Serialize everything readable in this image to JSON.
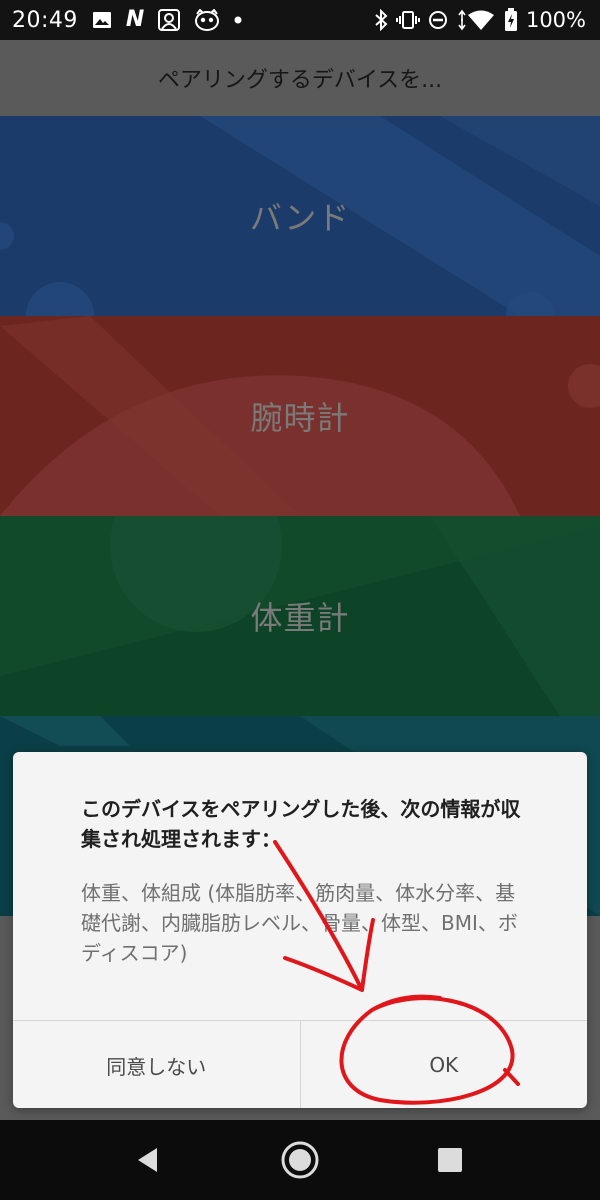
{
  "status_bar": {
    "time": "20:49",
    "notification_icons": [
      "image-icon",
      "n-app-icon",
      "person-app-icon",
      "raccoon-app-icon",
      "dot-icon"
    ],
    "system_icons": [
      "bluetooth-icon",
      "vibrate-icon",
      "do-not-disturb-icon",
      "wifi-icon",
      "battery-charging-icon"
    ],
    "notification_n_letter": "N",
    "battery_text": "100%"
  },
  "header": {
    "title": "ペアリングするデバイスを..."
  },
  "tiles": [
    {
      "label": "バンド",
      "color": "#1b3b6a"
    },
    {
      "label": "腕時計",
      "color": "#6d2520"
    },
    {
      "label": "体重計",
      "color": "#0d4427"
    },
    {
      "label": "",
      "color": "#0b3f47"
    }
  ],
  "dialog": {
    "title": "このデバイスをペアリングした後、次の情報が収集され処理されます：",
    "message": "体重、体組成 (体脂肪率、筋肉量、体水分率、基礎代謝、内臓脂肪レベル、骨量、体型、BMI、ボディスコア)",
    "decline_label": "同意しない",
    "ok_label": "OK"
  },
  "annotation": {
    "color": "#e0161b",
    "shapes": [
      "hand-drawn-arrow",
      "hand-drawn-circle"
    ]
  },
  "nav_bar": {
    "icons": [
      "back-icon",
      "home-icon",
      "recents-icon"
    ]
  }
}
